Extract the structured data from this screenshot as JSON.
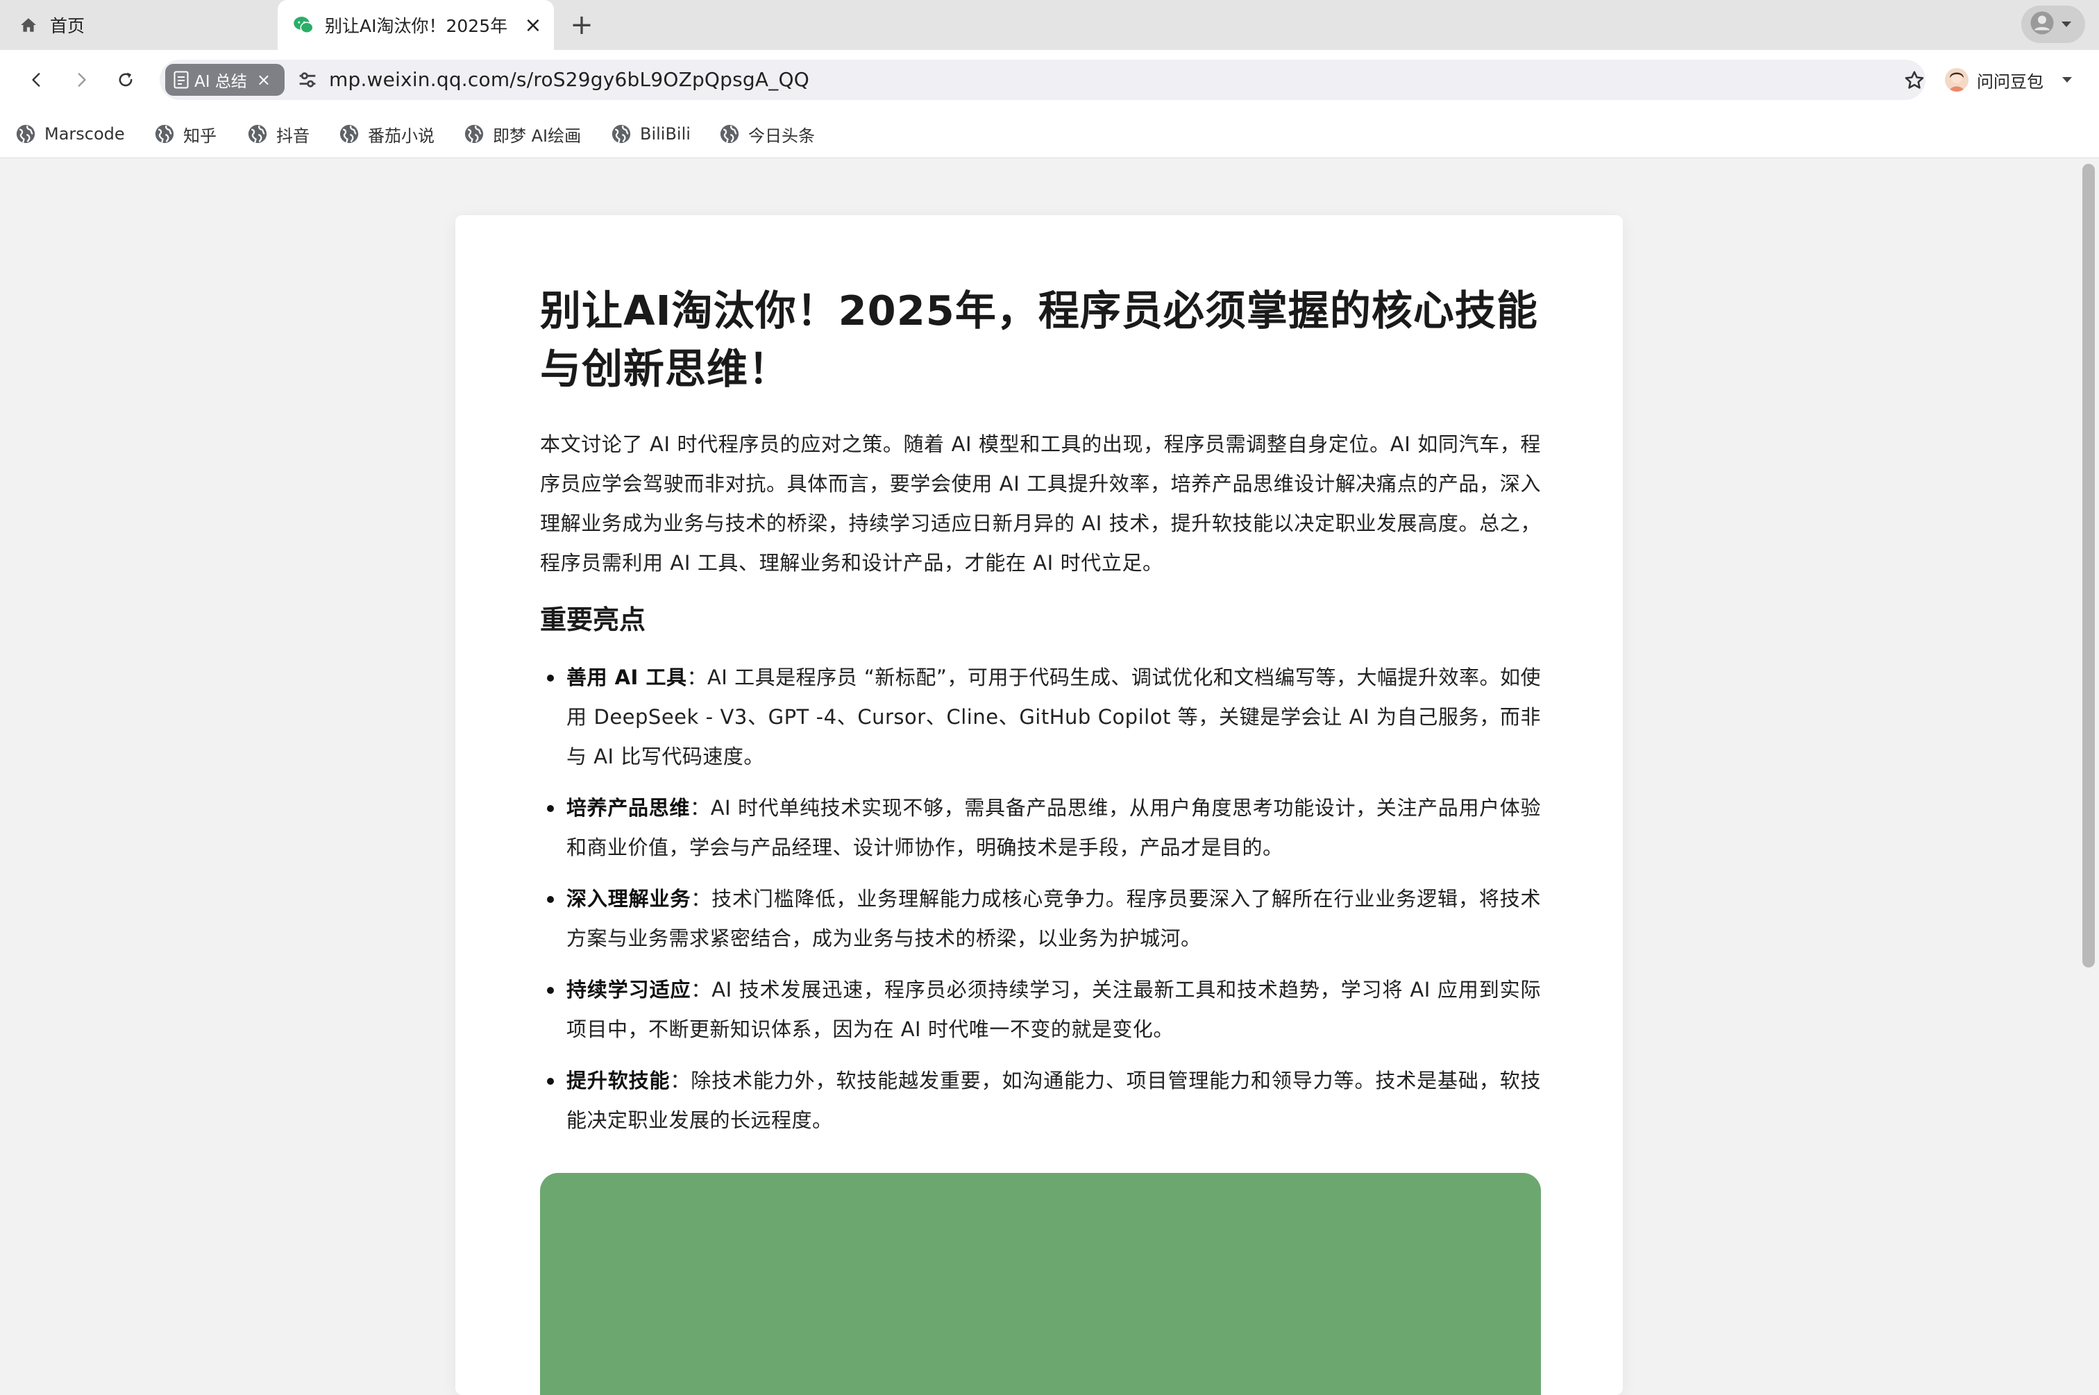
{
  "tabs": {
    "home_label": "首页",
    "active_title": "别让AI淘汰你！2025年",
    "close_symbol": "×",
    "new_tab_symbol": "+"
  },
  "toolbar": {
    "ai_chip_label": "AI 总结",
    "ai_chip_close": "×",
    "url": "mp.weixin.qq.com/s/roS29gy6bL9OZpQpsgA_QQ",
    "assistant_label": "问问豆包"
  },
  "bookmarks": [
    {
      "label": "Marscode"
    },
    {
      "label": "知乎"
    },
    {
      "label": "抖音"
    },
    {
      "label": "番茄小说"
    },
    {
      "label": "即梦 AI绘画"
    },
    {
      "label": "BiliBili"
    },
    {
      "label": "今日头条"
    }
  ],
  "article": {
    "title": "别让AI淘汰你！2025年，程序员必须掌握的核心技能与创新思维！",
    "summary": "本文讨论了 AI 时代程序员的应对之策。随着 AI 模型和工具的出现，程序员需调整自身定位。AI 如同汽车，程序员应学会驾驶而非对抗。具体而言，要学会使用 AI 工具提升效率，培养产品思维设计解决痛点的产品，深入理解业务成为业务与技术的桥梁，持续学习适应日新月异的 AI 技术，提升软技能以决定职业发展高度。总之，程序员需利用 AI 工具、理解业务和设计产品，才能在 AI 时代立足。",
    "highlights_heading": "重要亮点",
    "highlights": [
      {
        "term": "善用 AI 工具",
        "text": "：AI 工具是程序员 “新标配”，可用于代码生成、调试优化和文档编写等，大幅提升效率。如使用 DeepSeek - V3、GPT -4、Cursor、Cline、GitHub Copilot 等，关键是学会让 AI 为自己服务，而非与 AI 比写代码速度。"
      },
      {
        "term": "培养产品思维",
        "text": "：AI 时代单纯技术实现不够，需具备产品思维，从用户角度思考功能设计，关注产品用户体验和商业价值，学会与产品经理、设计师协作，明确技术是手段，产品才是目的。"
      },
      {
        "term": "深入理解业务",
        "text": "：技术门槛降低，业务理解能力成核心竞争力。程序员要深入了解所在行业业务逻辑，将技术方案与业务需求紧密结合，成为业务与技术的桥梁，以业务为护城河。"
      },
      {
        "term": "持续学习适应",
        "text": "：AI 技术发展迅速，程序员必须持续学习，关注最新工具和技术趋势，学习将 AI 应用到实际项目中，不断更新知识体系，因为在 AI 时代唯一不变的就是变化。"
      },
      {
        "term": "提升软技能",
        "text": "：除技术能力外，软技能越发重要，如沟通能力、项目管理能力和领导力等。技术是基础，软技能决定职业发展的长远程度。"
      }
    ]
  },
  "colors": {
    "green_block": "#6ca770",
    "wechat_green": "#2aae67"
  }
}
